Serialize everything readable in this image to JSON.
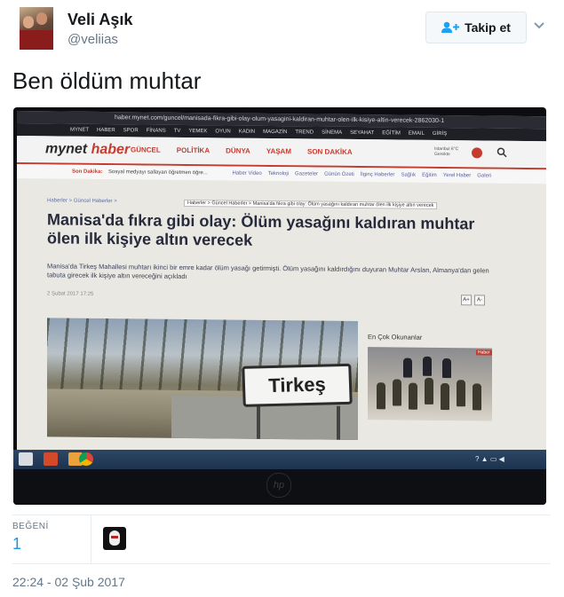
{
  "author": {
    "display_name": "Veli Aşık",
    "handle": "@veliias",
    "avatar_icon": "profile-photo"
  },
  "follow_button": {
    "label": "Takip et",
    "icon": "add-user-icon"
  },
  "tweet": {
    "text": "Ben öldüm muhtar"
  },
  "photo": {
    "browser_url": "haber.mynet.com/guncel/manisada-fikra-gibi-olay-olum-yasagini-kaldiran-muhtar-olen-ilk-kisiye-altin-verecek-2862030-1",
    "top_nav": [
      "MYNET",
      "HABER",
      "SPOR",
      "FİNANS",
      "TV",
      "YEMEK",
      "OYUN",
      "KADIN",
      "MAGAZİN",
      "TREND",
      "SİNEMA",
      "SEYAHAT",
      "EĞİTİM",
      "EMAIL",
      "GİRİŞ"
    ],
    "logo_main": "mynet",
    "logo_accent": "haber",
    "main_nav": [
      "GÜNCEL",
      "POLİTİKA",
      "DÜNYA",
      "YAŞAM",
      "SON DAKİKA"
    ],
    "weather": "Istanbul 6°C Gerekte",
    "breaking_label": "Son Dakika:",
    "breaking_text": "Sosyal medyayı sallayan öğretmen öğre...",
    "sub_nav": [
      "Haber Video",
      "Teknoloji",
      "Gazeteler",
      "Günün Özeti",
      "İlginç Haberler",
      "Sağlık",
      "Eğitim",
      "Yerel Haber",
      "Galeri"
    ],
    "breadcrumb": "Haberler > Güncel Haberler > Manisa'da fıkra gibi olay: Ölüm yasağını kaldıran muhtar ölen ilk kişiye altın verecek",
    "headline": "Manisa'da fıkra gibi olay: Ölüm yasağını kaldıran muhtar ölen ilk kişiye altın verecek",
    "lead": "Manisa'da Tirkeş Mahallesi muhtarı ikinci bir emre kadar ölüm yasağı getirmişti. Ölüm yasağını kaldırdığını duyuran Muhtar Arslan, Almanya'dan gelen tabuta girecek ilk kişiye altın vereceğini açıkladı",
    "date": "2 Şubat 2017 17:25",
    "font_up": "A+",
    "font_down": "A-",
    "sign_text": "Tirkeş",
    "side_label": "En Çok Okunanlar",
    "side_tag": "Haber",
    "monitor_brand": "hp"
  },
  "likes": {
    "label": "BEĞENİ",
    "count": "1"
  },
  "timestamp": "22:24 - 02 Şub 2017",
  "colors": {
    "link_blue": "#1b95e0",
    "muted": "#657786",
    "mynet_red": "#c63b2f"
  }
}
